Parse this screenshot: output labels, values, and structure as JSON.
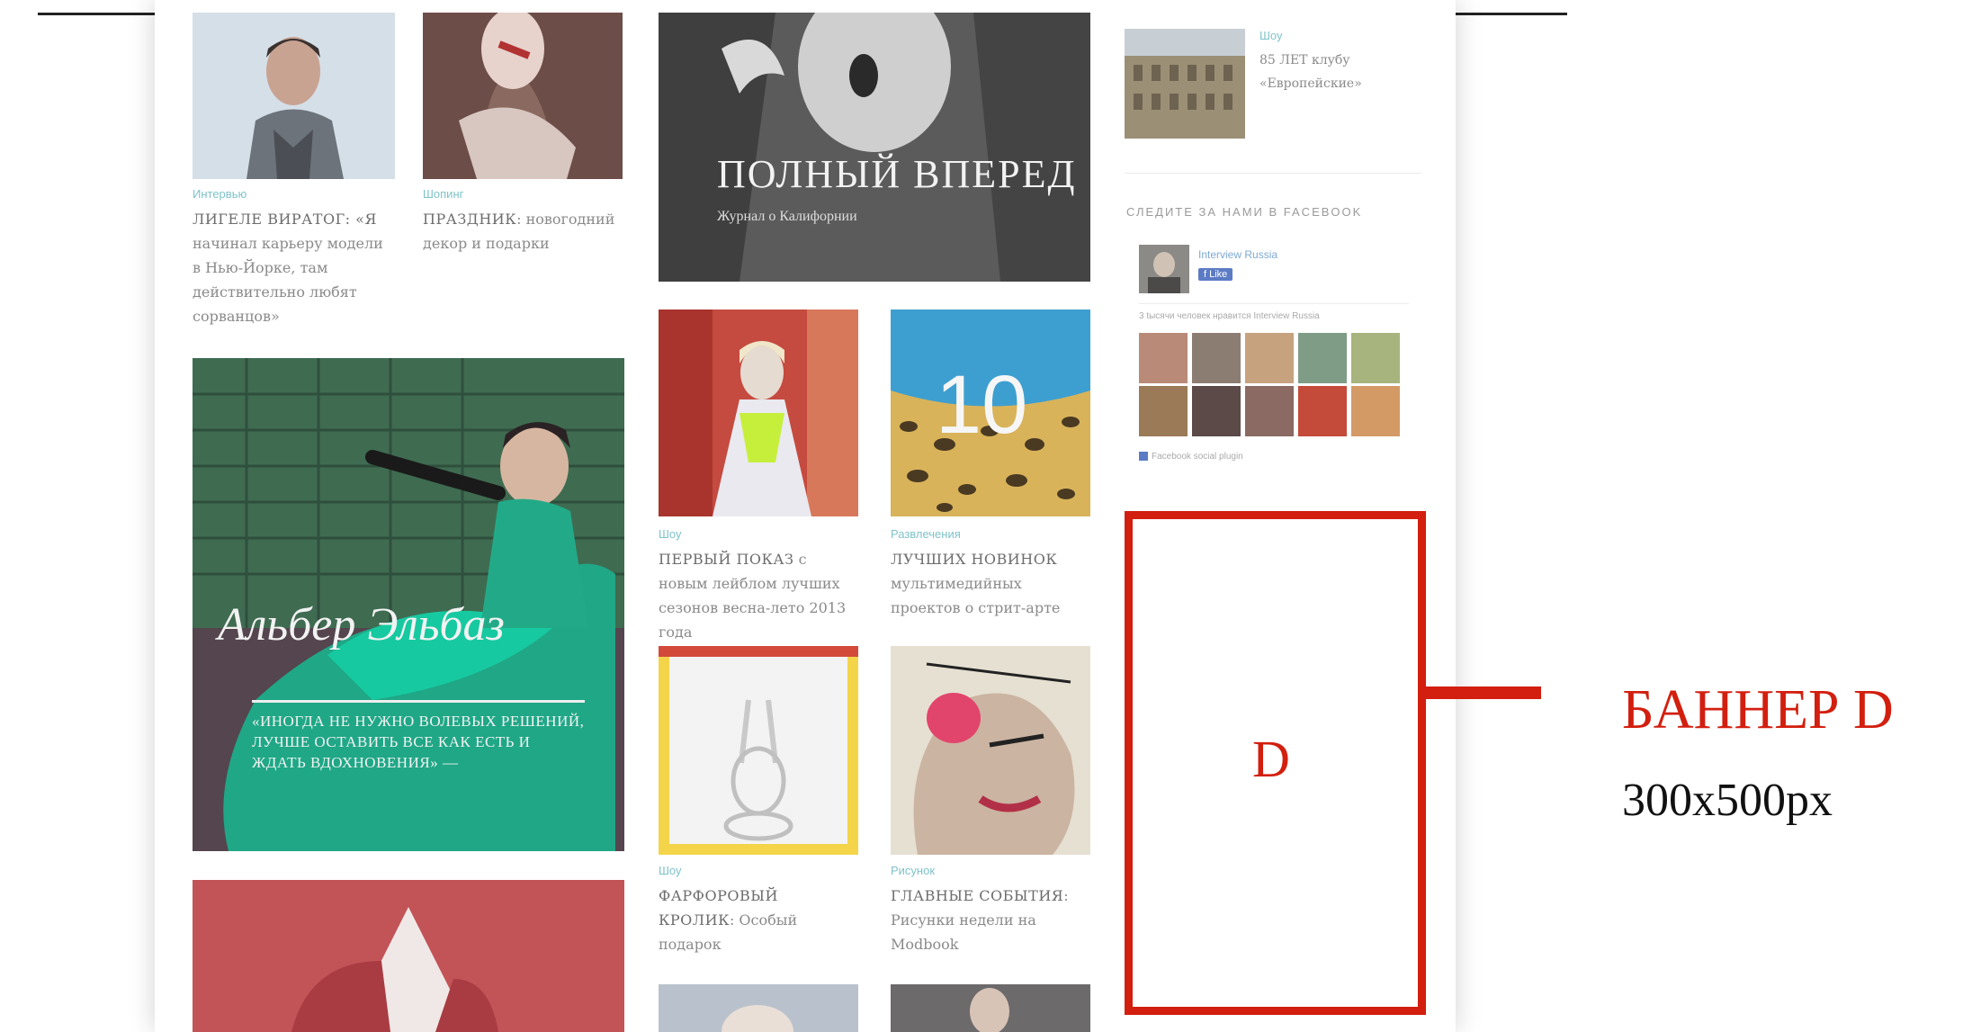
{
  "articles": {
    "a1": {
      "category": "Интервью",
      "title_caps": "ЛИГЕЛЕ ВИРАТОГ: «Я",
      "title_rest": "начинал карьеру модели в Нью-Йорке, там действительно любят сорванцов»"
    },
    "a2": {
      "category": "Шопинг",
      "title_caps": "ПРАЗДНИК",
      "title_rest": ": новогодний декор и подарки"
    },
    "a3": {
      "overlay_title": "ПОЛНЫЙ ВПЕРЕД",
      "overlay_sub": "Журнал о Калифорнии"
    },
    "a4": {
      "overlay_title": "Альбер Эльбаз",
      "overlay_sub": "«ИНОГДА НЕ НУЖНО ВОЛЕВЫХ РЕШЕНИЙ, ЛУЧШЕ ОСТАВИТЬ ВСЕ КАК ЕСТЬ И ЖДАТЬ ВДОХНОВЕНИЯ» —"
    },
    "a5": {
      "category": "Шоу",
      "title_caps": "ПЕРВЫЙ ПОКАЗ",
      "title_rest": " с новым лейблом лучших сезонов весна-лето 2013 года"
    },
    "a6": {
      "category": "Развлечения",
      "number": "10",
      "title_caps": "ЛУЧШИХ НОВИНОК",
      "title_rest": " мультимедийных проектов о стрит-арте"
    },
    "a7": {
      "category": "Шоу",
      "title_caps": "ФАРФОРОВЫЙ КРОЛИК",
      "title_rest": ": Особый подарок"
    },
    "a8": {
      "category": "Рисунок",
      "title_caps": "ГЛАВНЫЕ СОБЫТИЯ",
      "title_rest": ": Рисунки недели на Modbook"
    }
  },
  "sidebar": {
    "top_item": {
      "category": "Шоу",
      "title": "85 ЛЕТ клубу «Европейские»"
    },
    "facebook_title": "СЛЕДИТЕ ЗА НАМИ В FACEBOOK",
    "fb_page_name": "Interview Russia",
    "fb_like": "Like",
    "fb_fans_text": "3 tысячи человек нравится Interview Russia",
    "fb_plugin_text": "Facebook social plugin"
  },
  "banner": {
    "letter": "D",
    "title": "БАННЕР D",
    "size": "300x500px"
  },
  "colors": {
    "accent": "#d21f0f",
    "category": "#7fc3c9",
    "text": "#8a8a8a"
  }
}
